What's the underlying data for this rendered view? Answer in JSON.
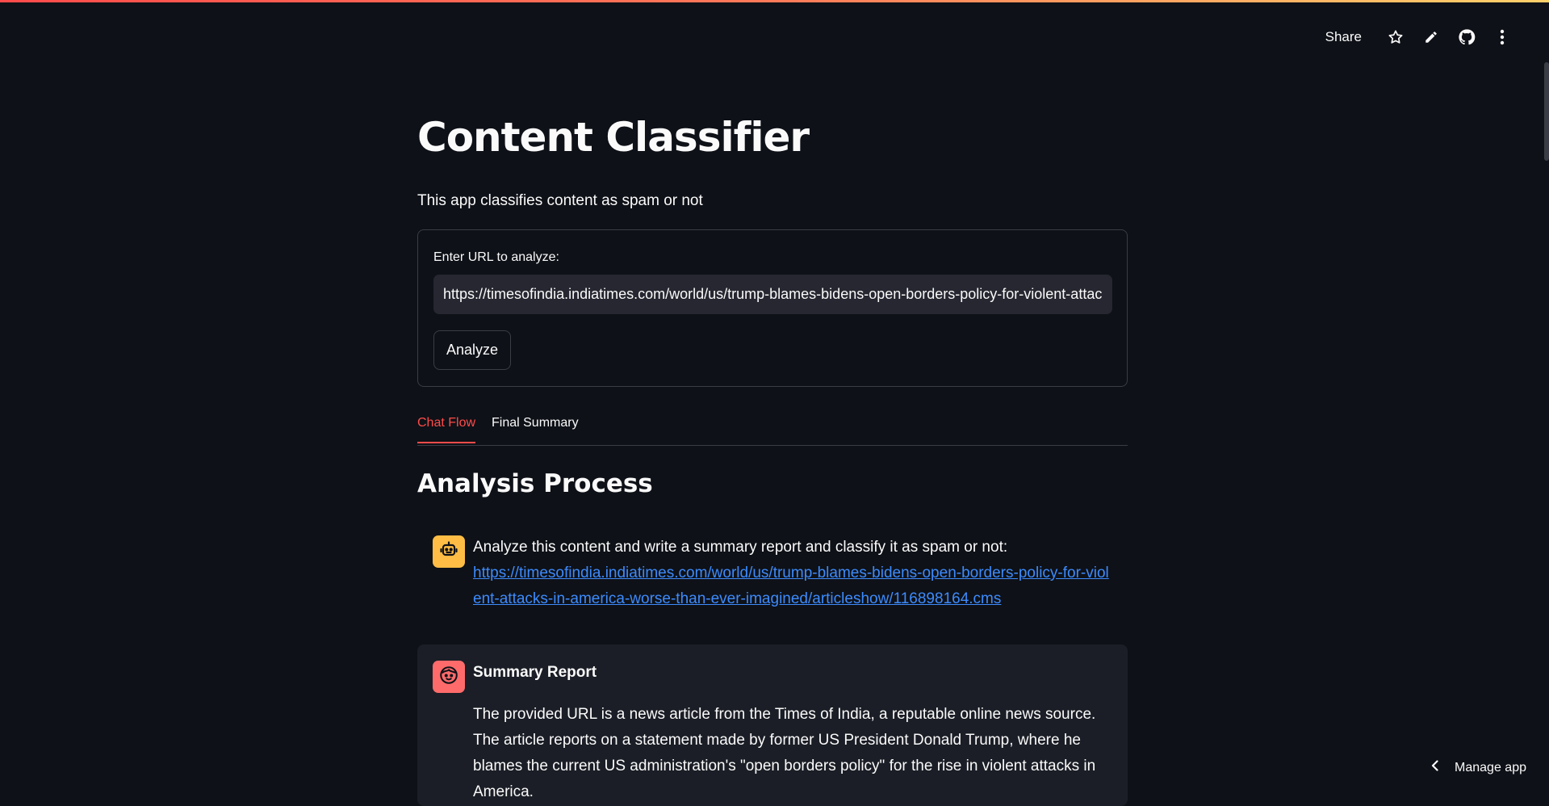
{
  "header": {
    "share_label": "Share",
    "icons": [
      "star-icon",
      "pencil-icon",
      "github-icon",
      "kebab-menu-icon"
    ]
  },
  "app": {
    "title": "Content Classifier",
    "subtitle": "This app classifies content as spam or not"
  },
  "form": {
    "label": "Enter URL to analyze:",
    "url_value": "https://timesofindia.indiatimes.com/world/us/trump-blames-bidens-open-borders-policy-for-violent-attacks-in-america-worse-than-ever-imagined/articleshow/116898164.cms",
    "analyze_label": "Analyze"
  },
  "tabs": [
    {
      "label": "Chat Flow",
      "active": true
    },
    {
      "label": "Final Summary",
      "active": false
    }
  ],
  "section": {
    "heading": "Analysis Process"
  },
  "messages": {
    "user": {
      "avatar_icon": "robot-icon",
      "text": "Analyze this content and write a summary report and classify it as spam or not:",
      "link": "https://timesofindia.indiatimes.com/world/us/trump-blames-bidens-open-borders-policy-for-violent-attacks-in-america-worse-than-ever-imagined/articleshow/116898164.cms"
    },
    "assistant": {
      "avatar_icon": "face-icon",
      "title": "Summary Report",
      "text": "The provided URL is a news article from the Times of India, a reputable online news source. The article reports on a statement made by former US President Donald Trump, where he blames the current US administration's \"open borders policy\" for the rise in violent attacks in America."
    }
  },
  "footer": {
    "manage_label": "Manage app"
  },
  "colors": {
    "background": "#0e1117",
    "accent": "#ff4b4b",
    "user_avatar": "#ffbd45",
    "assistant_avatar": "#ff6b6b",
    "link": "#3d8bfd"
  }
}
